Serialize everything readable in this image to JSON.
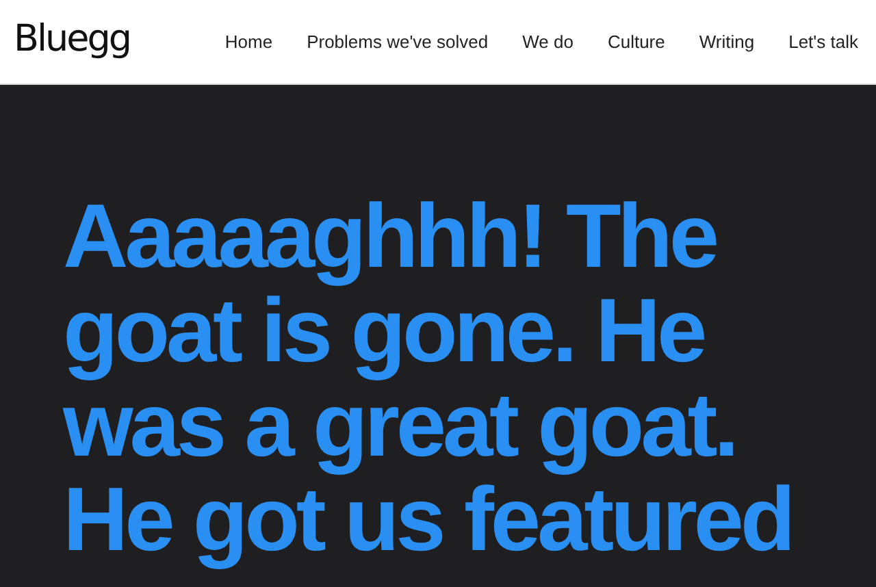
{
  "header": {
    "logo": "Bluegg",
    "nav": [
      {
        "label": "Home"
      },
      {
        "label": "Problems we've solved"
      },
      {
        "label": "We do"
      },
      {
        "label": "Culture"
      },
      {
        "label": "Writing"
      },
      {
        "label": "Let's talk"
      }
    ]
  },
  "hero": {
    "headline": "Aaaaaghhh! The goat is gone. He was a great goat. He got us featured"
  }
}
